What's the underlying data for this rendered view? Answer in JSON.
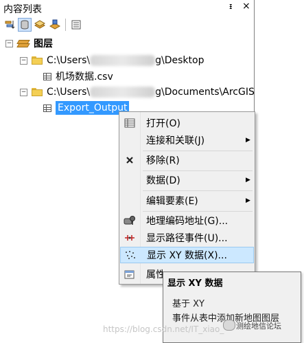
{
  "panel": {
    "title": "内容列表",
    "pin_glyph": "ᵻ",
    "close_glyph": "×"
  },
  "toolbar": [
    {
      "name": "list-by-drawing-order",
      "icon": "list-drawing-order-icon",
      "active": false
    },
    {
      "name": "list-by-source",
      "icon": "list-by-source-icon",
      "active": true
    },
    {
      "name": "list-by-visibility",
      "icon": "list-by-visibility-icon",
      "active": false
    },
    {
      "name": "list-by-selection",
      "icon": "list-by-selection-icon",
      "active": false
    },
    {
      "name": "options",
      "icon": "options-icon",
      "active": false
    }
  ],
  "tree": {
    "root_label": "图层",
    "folder1": {
      "prefix": "C:\\Users\\",
      "suffix": "g\\Desktop"
    },
    "file1": "机场数据.csv",
    "folder2": {
      "prefix": "C:\\Users\\",
      "suffix": "g\\Documents\\ArcGIS"
    },
    "table2": "Export_Output",
    "expander_open": "−"
  },
  "menu": {
    "open": "打开(O)",
    "joins": "连接和关联(J)",
    "remove": "移除(R)",
    "data": "数据(D)",
    "edit_features": "编辑要素(E)",
    "geocode": "地理编码地址(G)...",
    "route_events": "显示路径事件(U)...",
    "display_xy": "显示 XY 数据(X)...",
    "properties": "属性",
    "submenu_arrow": "▶"
  },
  "tooltip": {
    "title": "显示 XY 数据",
    "line1": "基于 XY",
    "line2": "事件从表中添加新地图图层"
  },
  "watermark": {
    "url": "https://blog.csdn.net/IT_xiao_",
    "brand": "测绘地信论坛"
  }
}
